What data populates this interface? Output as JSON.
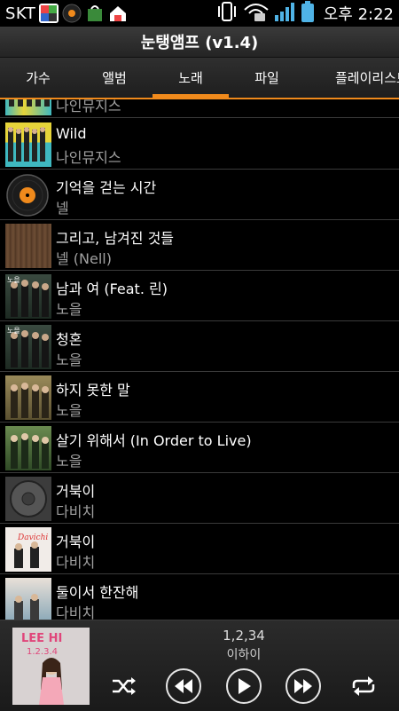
{
  "status_bar": {
    "carrier": "SKT",
    "time": "오후 2:22"
  },
  "app": {
    "title": "눈탱앰프 (v1.4)"
  },
  "tabs": [
    {
      "label": "가수",
      "active": false
    },
    {
      "label": "앨범",
      "active": false
    },
    {
      "label": "노래",
      "active": true
    },
    {
      "label": "파일",
      "active": false
    },
    {
      "label": "플레이리스트",
      "active": false
    }
  ],
  "songs": [
    {
      "title": "",
      "artist": "나인뮤지스",
      "art": "ninemuses"
    },
    {
      "title": "Wild",
      "artist": "나인뮤지스",
      "art": "ninemuses"
    },
    {
      "title": "기억을 걷는 시간",
      "artist": "넬",
      "art": "vinyl"
    },
    {
      "title": "그리고, 남겨진 것들",
      "artist": "넬 (Nell)",
      "art": "brown"
    },
    {
      "title": "남과 여 (Feat. 린)",
      "artist": "노을",
      "art": "noeul"
    },
    {
      "title": "청혼",
      "artist": "노을",
      "art": "noeul"
    },
    {
      "title": "하지 못한 말",
      "artist": "노을",
      "art": "noeul2"
    },
    {
      "title": "살기 위해서 (In Order to Live)",
      "artist": "노을",
      "art": "noeul3"
    },
    {
      "title": "거북이",
      "artist": "다비치",
      "art": "disc"
    },
    {
      "title": "거북이",
      "artist": "다비치",
      "art": "davichi"
    },
    {
      "title": "둘이서 한잔해",
      "artist": "다비치",
      "art": "davichi2"
    }
  ],
  "now_playing": {
    "title": "1,2,34",
    "artist": "이하이",
    "album_text": "LEE HI\n1.2.3.4"
  },
  "colors": {
    "accent": "#f08a1c",
    "artist_text": "#a0a0a0"
  }
}
